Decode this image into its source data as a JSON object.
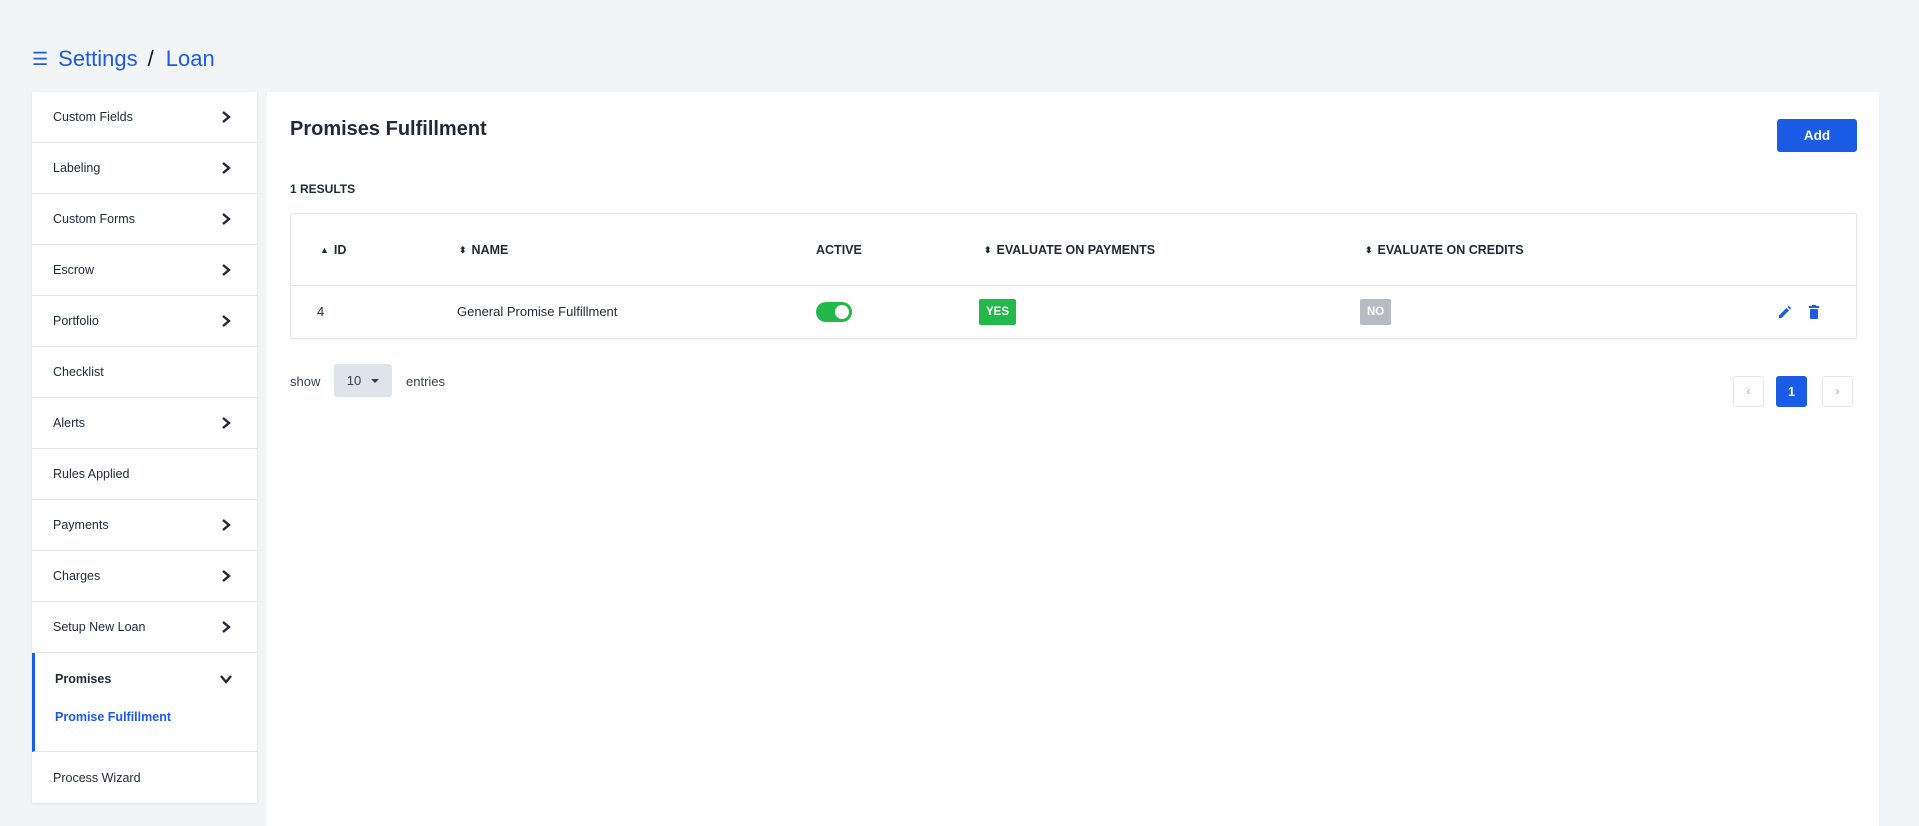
{
  "breadcrumb": {
    "menu_icon": "☰",
    "settings": "Settings",
    "separator": "/",
    "current": "Loan"
  },
  "sidebar": {
    "items": [
      {
        "label": "Custom Fields"
      },
      {
        "label": "Labeling"
      },
      {
        "label": "Custom Forms"
      },
      {
        "label": "Escrow"
      },
      {
        "label": "Portfolio"
      },
      {
        "label": "Checklist"
      },
      {
        "label": "Alerts"
      },
      {
        "label": "Rules Applied"
      },
      {
        "label": "Payments"
      },
      {
        "label": "Charges"
      },
      {
        "label": "Setup New Loan"
      }
    ],
    "active_group": {
      "label": "Promises",
      "sub_item": "Promise Fulfillment"
    },
    "last_item": "Process Wizard"
  },
  "main": {
    "title": "Promises Fulfillment",
    "add_label": "Add",
    "results": "1 RESULTS",
    "table": {
      "headers": {
        "id": "ID",
        "name": "NAME",
        "active": "ACTIVE",
        "evaluate_on_payments": "EVALUATE ON PAYMENTS",
        "evaluate_on_credits": "EVALUATE ON CREDITS"
      },
      "rows": [
        {
          "id": "4",
          "name": "General Promise Fulfillment",
          "active": true,
          "evaluate_on_payments": "YES",
          "evaluate_on_credits": "NO"
        }
      ]
    },
    "show_label": "show",
    "entries_value": "10",
    "entries_label": "entries",
    "pagination": {
      "prev": "‹",
      "current": "1",
      "next": "›"
    }
  },
  "colors": {
    "accent": "#1a5ce6",
    "success": "#22b84a",
    "muted_badge": "#b8bcc2",
    "background": "#f3f4f6"
  }
}
